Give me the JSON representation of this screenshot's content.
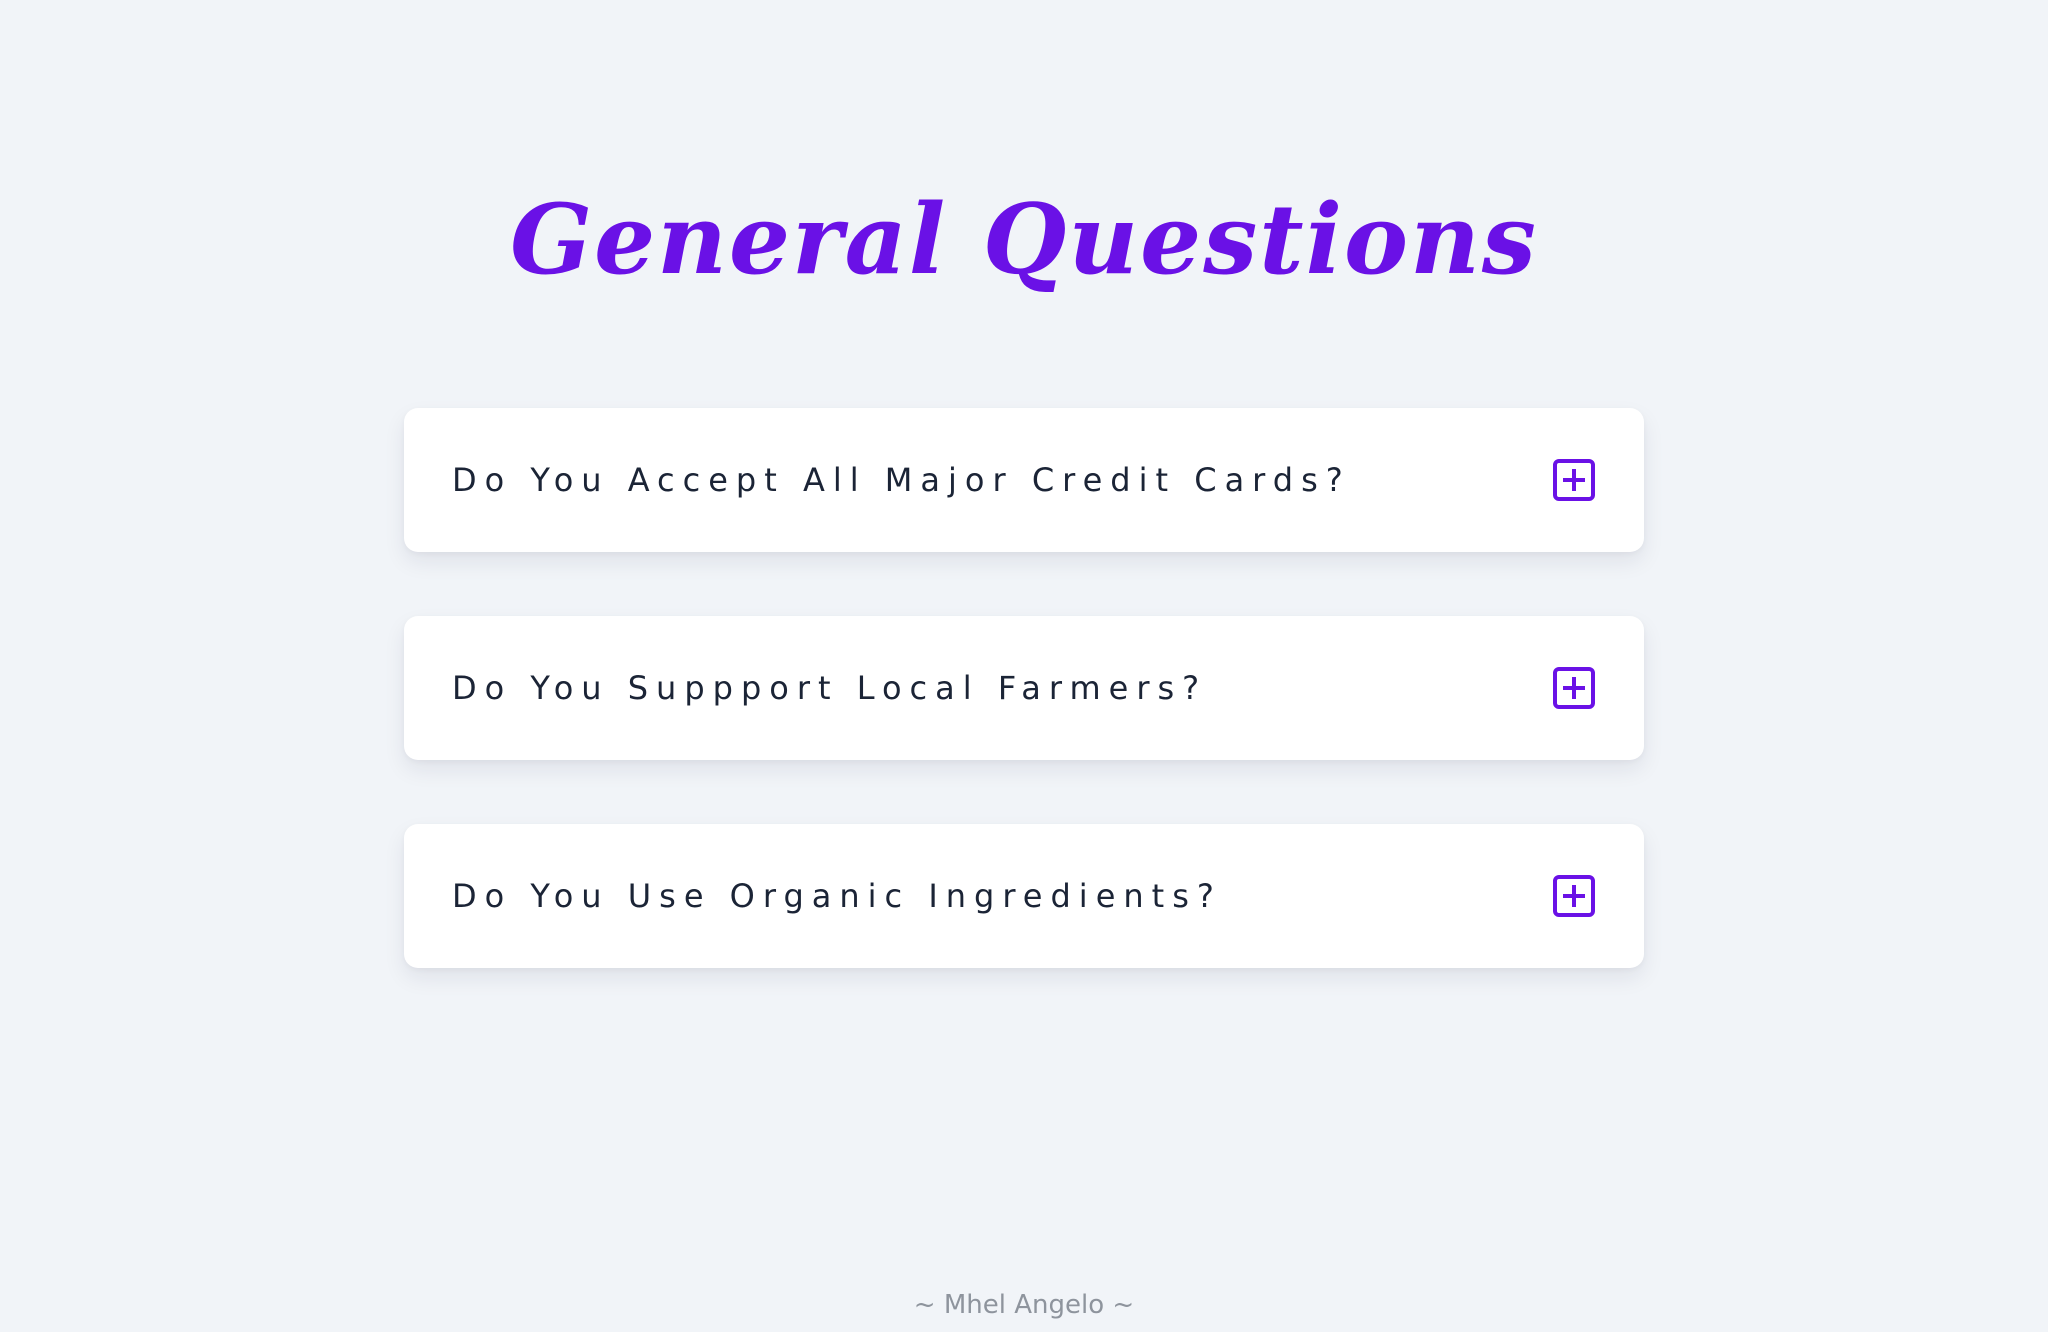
{
  "header": {
    "title": "General Questions"
  },
  "faq": {
    "items": [
      {
        "question": "Do You Accept All Major Credit Cards?",
        "toggle_icon": "plus-square-icon"
      },
      {
        "question": "Do You Suppport Local Farmers?",
        "toggle_icon": "plus-square-icon"
      },
      {
        "question": "Do You Use Organic Ingredients?",
        "toggle_icon": "plus-square-icon"
      }
    ]
  },
  "footer": {
    "credit": "~ Mhel Angelo ~"
  },
  "colors": {
    "background": "#f1f4f8",
    "accent": "#6a11e6",
    "card": "#ffffff",
    "question_text": "#1b2436",
    "footer_text": "#8e949d"
  }
}
